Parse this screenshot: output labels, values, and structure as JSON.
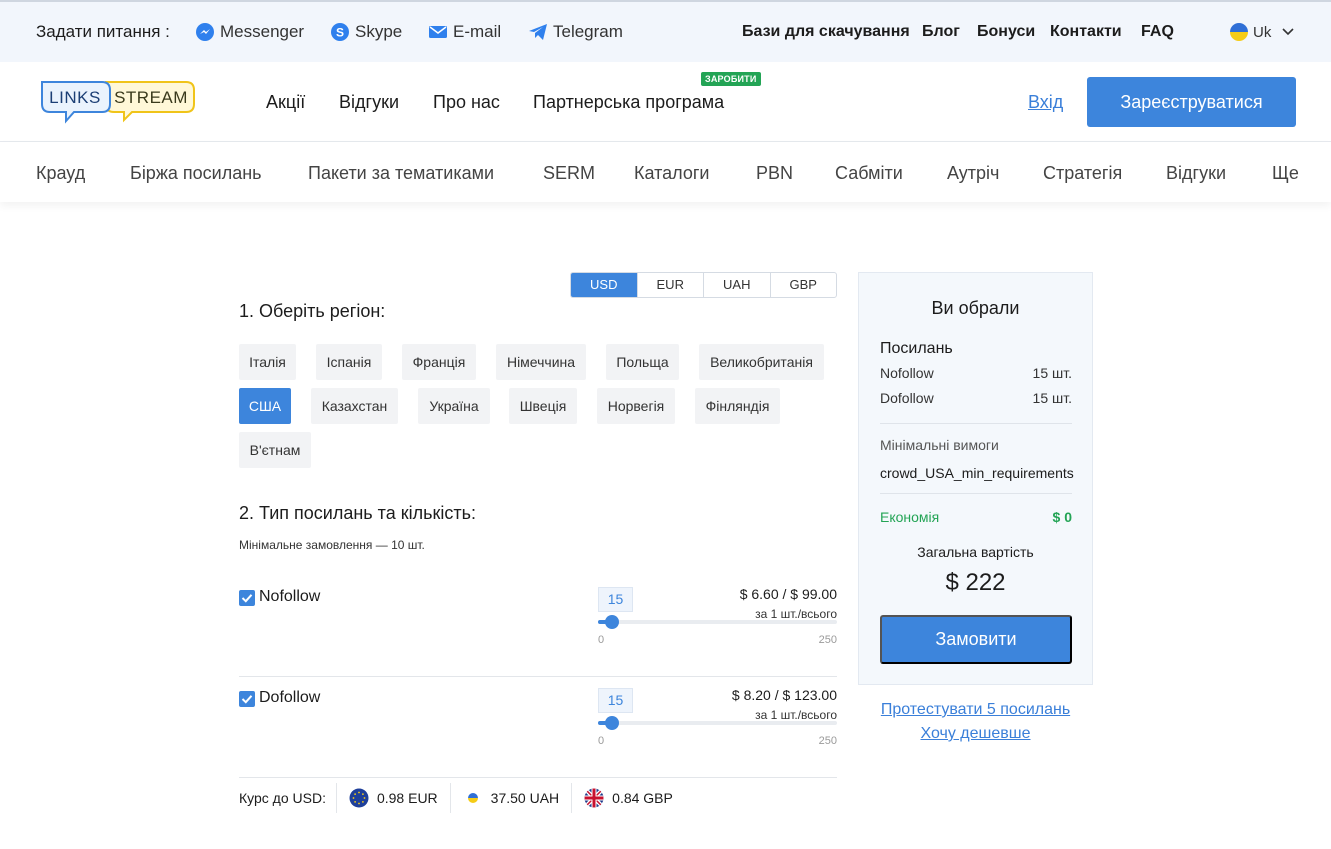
{
  "topbar": {
    "ask": "Задати питання :",
    "contacts": [
      {
        "label": "Messenger",
        "icon": "messenger-icon"
      },
      {
        "label": "Skype",
        "icon": "skype-icon"
      },
      {
        "label": "E-mail",
        "icon": "email-icon"
      },
      {
        "label": "Telegram",
        "icon": "telegram-icon"
      }
    ],
    "links": [
      "Бази для скачування",
      "Блог",
      "Бонуси",
      "Контакти",
      "FAQ"
    ],
    "language": "Uk"
  },
  "header": {
    "logo_left": "LINKS",
    "logo_right": "STREAM",
    "nav": [
      "Акції",
      "Відгуки",
      "Про нас",
      "Партнерська програма"
    ],
    "earn_badge": "ЗАРОБИТИ",
    "login": "Вхід",
    "register": "Зареєструватися"
  },
  "services": [
    "Крауд",
    "Біржа посилань",
    "Пакети за тематиками",
    "SERM",
    "Каталоги",
    "PBN",
    "Сабміти",
    "Аутріч",
    "Стратегія",
    "Відгуки",
    "Ще"
  ],
  "calculator": {
    "currencies": [
      "USD",
      "EUR",
      "UAH",
      "GBP"
    ],
    "selected_currency": "USD",
    "step1": "1. Оберіть регіон:",
    "regions": [
      "Італія",
      "Іспанія",
      "Франція",
      "Німеччина",
      "Польща",
      "Великобританія",
      "США",
      "Казахстан",
      "Україна",
      "Швеція",
      "Норвегія",
      "Фінляндія",
      "В'єтнам"
    ],
    "selected_region": "США",
    "step2": "2. Тип посилань та кількість:",
    "min_order": "Мінімальне замовлення — 10 шт.",
    "link_types": [
      {
        "label": "Nofollow",
        "checked": true,
        "qty": "15",
        "price": "$ 6.60 / $ 99.00",
        "per": "за 1 шт./всього",
        "min": "0",
        "max": "250",
        "value": 15
      },
      {
        "label": "Dofollow",
        "checked": true,
        "qty": "15",
        "price": "$ 8.20 / $ 123.00",
        "per": "за 1 шт./всього",
        "min": "0",
        "max": "250",
        "value": 15
      }
    ],
    "rates_label": "Курс до USD:",
    "rates": [
      "0.98 EUR",
      "37.50 UAH",
      "0.84 GBP"
    ]
  },
  "summary": {
    "title": "Ви обрали",
    "section": "Посилань",
    "rows": [
      {
        "label": "Nofollow",
        "value": "15 шт."
      },
      {
        "label": "Dofollow",
        "value": "15 шт."
      }
    ],
    "min_req_label": "Мінімальні вимоги",
    "min_req_value": "crowd_USA_min_requirements",
    "economy_label": "Економія",
    "economy_value": "$ 0",
    "total_label": "Загальна вартість",
    "total_value": "$ 222",
    "order_button": "Замовити",
    "test_link": "Протестувати 5 посилань",
    "cheaper_link": "Хочу дешевше"
  },
  "colors": {
    "accent": "#3d85dc",
    "green": "#23a455",
    "topbar_bg": "#f2f6fc"
  }
}
